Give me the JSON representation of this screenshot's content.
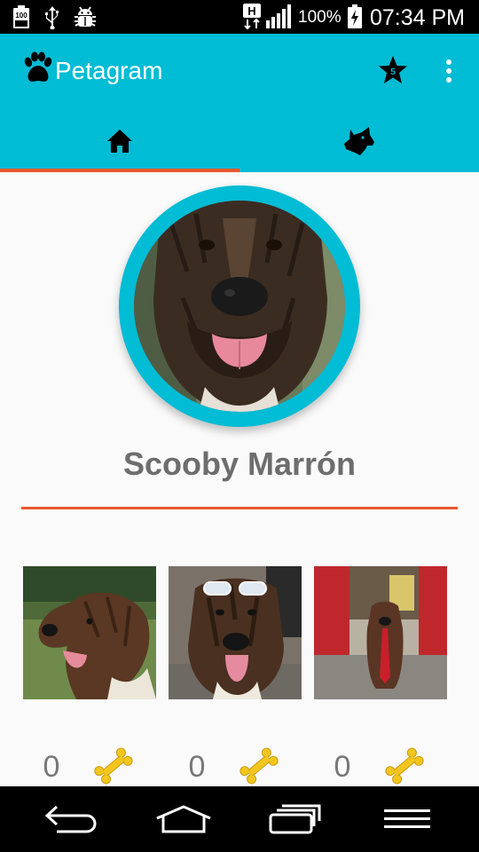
{
  "status_bar": {
    "battery_percent": "100%",
    "time": "07:34 PM",
    "battery_level_badge": "100",
    "network_letter": "H",
    "icons": [
      "battery-saver-icon",
      "usb-icon",
      "android-debug-icon",
      "network-h-icon",
      "signal-icon",
      "battery-charging-icon"
    ]
  },
  "toolbar": {
    "title": "Petagram",
    "favorites_count": "5",
    "icons": [
      "paw-icon",
      "star-favorites-icon",
      "overflow-menu-icon"
    ]
  },
  "tabs": [
    {
      "id": "home",
      "icon": "home-icon",
      "selected": true
    },
    {
      "id": "profile",
      "icon": "dog-head-icon",
      "selected": false
    }
  ],
  "profile": {
    "name": "Scooby Marrón"
  },
  "photos": [
    {
      "likes": "0",
      "icon": "bone-icon"
    },
    {
      "likes": "0",
      "icon": "bone-icon"
    },
    {
      "likes": "0",
      "icon": "bone-icon"
    }
  ],
  "colors": {
    "primary": "#00bcd4",
    "accent": "#e9582f",
    "background": "#fafafa",
    "text": "#6d6d6d"
  },
  "nav_bar": {
    "icons": [
      "back-icon",
      "home-nav-icon",
      "recents-icon",
      "menu-icon"
    ]
  }
}
